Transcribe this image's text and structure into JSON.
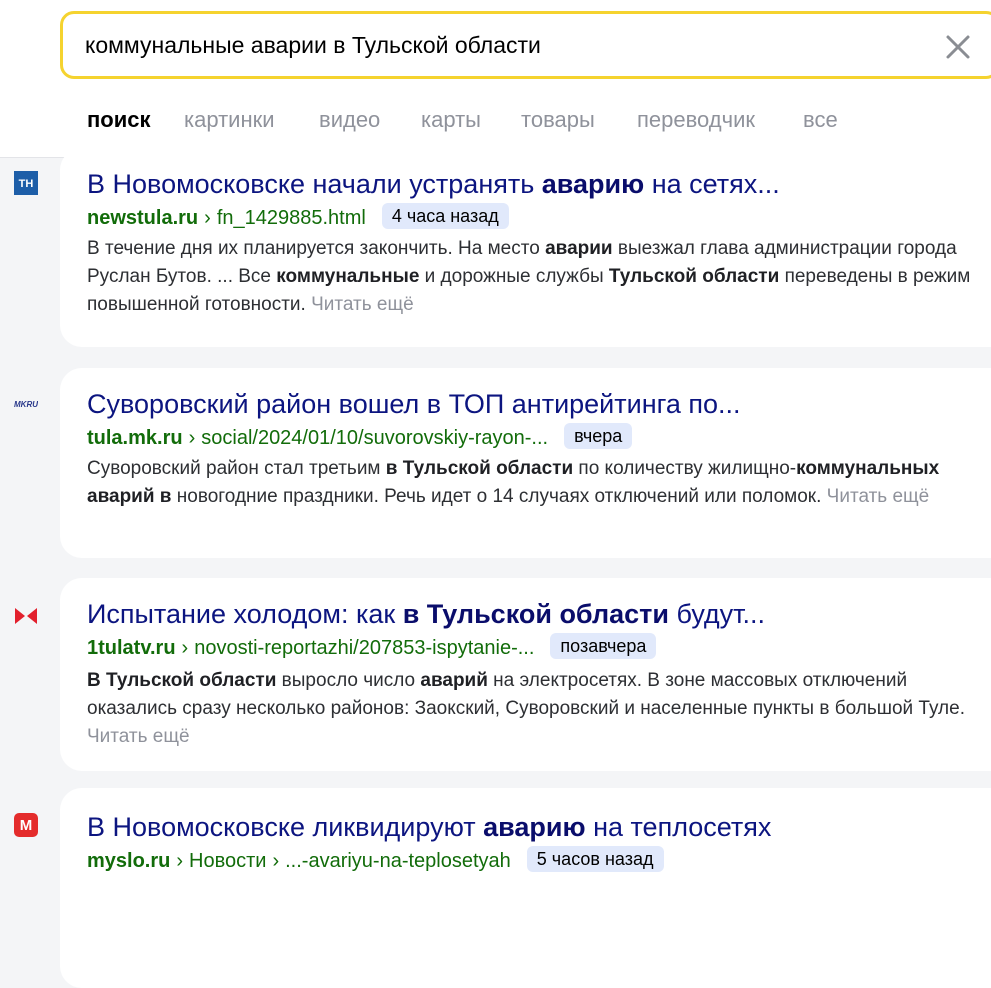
{
  "search": {
    "query": "коммунальные аварии в Тульской области",
    "placeholder": ""
  },
  "tabs": [
    {
      "label": "поиск",
      "active": true
    },
    {
      "label": "картинки"
    },
    {
      "label": "видео"
    },
    {
      "label": "карты"
    },
    {
      "label": "товары"
    },
    {
      "label": "переводчик"
    },
    {
      "label": "все"
    }
  ],
  "results": [
    {
      "favicon": "newstula-favicon",
      "favicon_text": "ТН",
      "title_parts": [
        {
          "t": "В Новомосковске начали устранять "
        },
        {
          "t": "аварию",
          "b": true
        },
        {
          "t": " на сетях..."
        }
      ],
      "domain": "newstula.ru",
      "path": [
        "fn_1429885.html"
      ],
      "time": "4 часа назад",
      "snippet_parts": [
        {
          "t": "В течение дня их планируется закончить. На место "
        },
        {
          "t": "аварии",
          "b": true
        },
        {
          "t": " выезжал глава администрации города Руслан Бутов. ... Все "
        },
        {
          "t": "коммунальные",
          "b": true
        },
        {
          "t": " и дорожные службы "
        },
        {
          "t": "Тульской области",
          "b": true
        },
        {
          "t": " переведены в режим повышенной готовности. "
        }
      ],
      "more": "Читать ещё"
    },
    {
      "favicon": "mk-favicon",
      "favicon_text": "MKRU",
      "title_parts": [
        {
          "t": "Суворовский район вошел в ТОП антирейтинга по..."
        }
      ],
      "domain": "tula.mk.ru",
      "path": [
        "social/2024/01/10/suvorovskiy-rayon-..."
      ],
      "time": "вчера",
      "snippet_parts": [
        {
          "t": "Суворовский район стал третьим "
        },
        {
          "t": "в Тульской области",
          "b": true
        },
        {
          "t": " по количеству жилищно-"
        },
        {
          "t": "коммунальных аварий в",
          "b": true
        },
        {
          "t": " новогодние праздники. Речь идет о 14 случаях отключений или поломок. "
        }
      ],
      "more": "Читать ещё"
    },
    {
      "favicon": "1tulatv-favicon",
      "favicon_text": "",
      "title_parts": [
        {
          "t": "Испытание холодом: как "
        },
        {
          "t": "в Тульской области",
          "b": true
        },
        {
          "t": " будут..."
        }
      ],
      "domain": "1tulatv.ru",
      "path": [
        "novosti-reportazhi/207853-ispytanie-..."
      ],
      "time": "позавчера",
      "snippet_parts": [
        {
          "t": "В Тульской области",
          "b": true
        },
        {
          "t": " выросло число "
        },
        {
          "t": "аварий",
          "b": true
        },
        {
          "t": " на электросетях. В зоне массовых отключений оказались сразу несколько районов: Заокский, Суворовский и населенные пункты в большой Туле. "
        }
      ],
      "more": "Читать ещё"
    },
    {
      "favicon": "myslo-favicon",
      "favicon_text": "M",
      "title_parts": [
        {
          "t": "В Новомосковске ликвидируют "
        },
        {
          "t": "аварию",
          "b": true
        },
        {
          "t": " на теплосетях"
        }
      ],
      "domain": "myslo.ru",
      "path": [
        "Новости",
        "...-avariyu-na-teplosetyah"
      ],
      "time": "5 часов назад",
      "snippet_parts": [],
      "more": ""
    }
  ],
  "colors": {
    "accent_yellow": "#f5d32f",
    "title_blue": "#0c1580",
    "url_green": "#126c0a",
    "badge_bg": "#e1e9fb"
  }
}
